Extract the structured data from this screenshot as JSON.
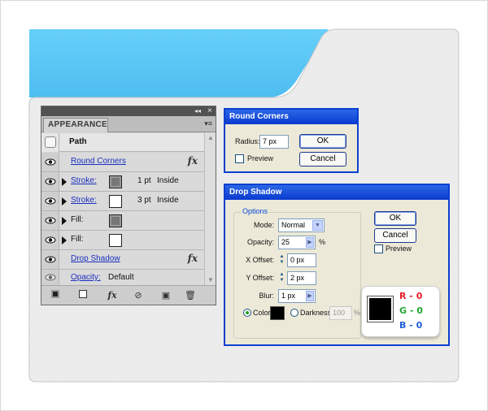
{
  "appearance_panel": {
    "tab_label": "APPEARANCE",
    "collapse_glyph": "◂◂",
    "close_glyph": "×",
    "menu_glyph": "▾≡",
    "path_label": "Path",
    "rows": [
      {
        "label": "Round Corners",
        "fx": "fx"
      },
      {
        "label": "Stroke:",
        "value": "1 pt",
        "align": "Inside"
      },
      {
        "label": "Stroke:",
        "value": "3 pt",
        "align": "Inside"
      },
      {
        "label": "Fill:"
      },
      {
        "label": "Fill:"
      },
      {
        "label": "Drop Shadow",
        "fx": "fx"
      },
      {
        "label": "Opacity:",
        "value": "Default"
      }
    ],
    "bottom_icons": [
      "new-art-icon",
      "clear-appearance-icon",
      "add-effect-icon",
      "clear-icon",
      "duplicate-icon",
      "delete-icon"
    ]
  },
  "round_corners_dialog": {
    "title": "Round Corners",
    "radius_label": "Radius:",
    "radius_value": "7 px",
    "preview_label": "Preview",
    "ok_label": "OK",
    "cancel_label": "Cancel"
  },
  "drop_shadow_dialog": {
    "title": "Drop Shadow",
    "options_legend": "Options",
    "mode_label": "Mode:",
    "mode_value": "Normal",
    "opacity_label": "Opacity:",
    "opacity_value": "25",
    "opacity_unit": "%",
    "x_offset_label": "X Offset:",
    "x_offset_value": "0 px",
    "y_offset_label": "Y Offset:",
    "y_offset_value": "2 px",
    "blur_label": "Blur:",
    "blur_value": "1 px",
    "color_label": "Color:",
    "darkness_label": "Darkness:",
    "darkness_value": "100",
    "darkness_unit": "%",
    "ok_label": "OK",
    "cancel_label": "Cancel",
    "preview_label": "Preview"
  },
  "rgb_badge": {
    "r_text": "R - 0",
    "g_text": "G - 0",
    "b_text": "B - 0",
    "colors": {
      "r": "#e8202a",
      "g": "#21a835",
      "b": "#1f5fd6",
      "swatch": "#000000"
    }
  },
  "colors": {
    "accent_blue": "#5bc8f5",
    "card": "#eeeeee",
    "dialog_title": "#0a3ad0"
  }
}
